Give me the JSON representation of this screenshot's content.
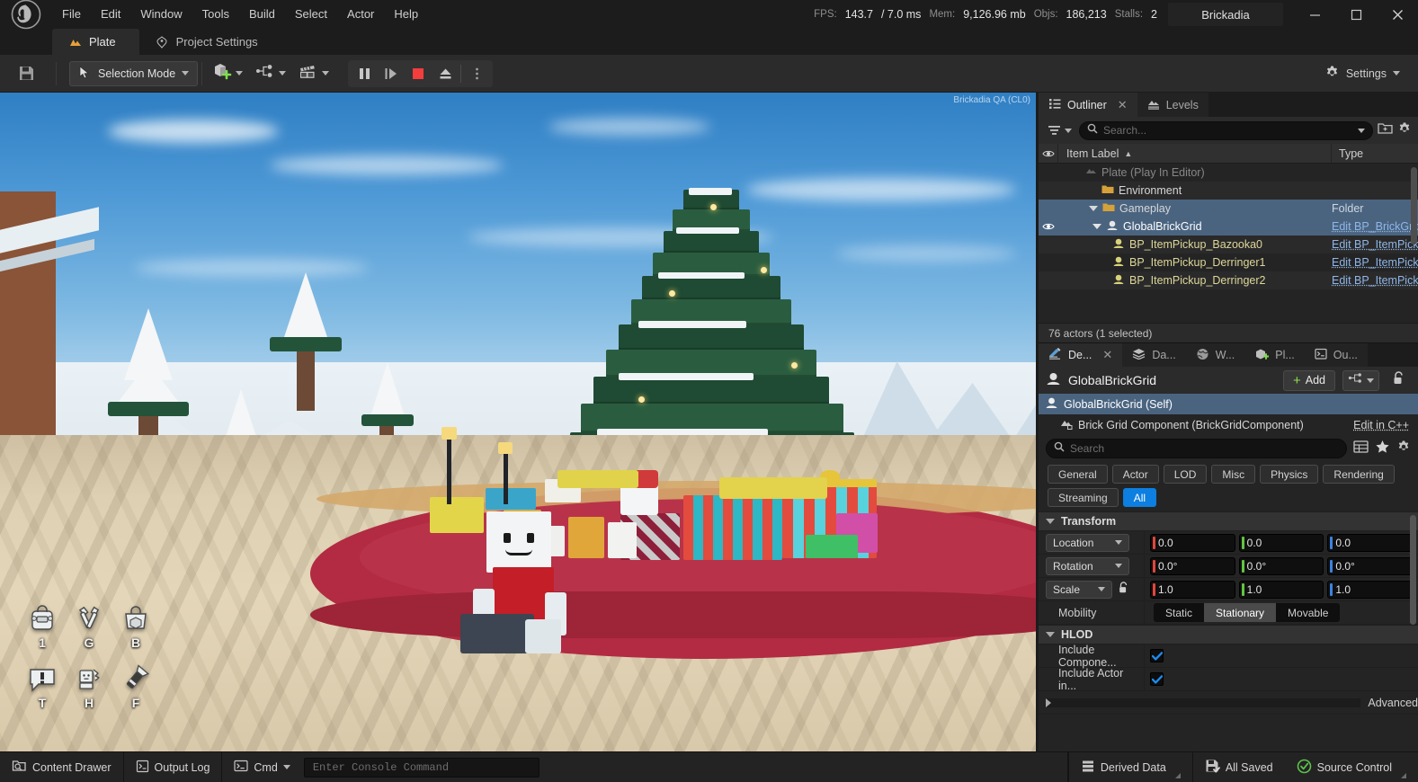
{
  "window": {
    "project_name": "Brickadia",
    "minimize": "—",
    "maximize": "□",
    "close": "✕"
  },
  "menu": {
    "items": [
      "File",
      "Edit",
      "Window",
      "Tools",
      "Build",
      "Select",
      "Actor",
      "Help"
    ]
  },
  "stats": {
    "fps_label": "FPS:",
    "fps_value": "143.7",
    "frametime": "/ 7.0 ms",
    "mem_label": "Mem:",
    "mem_value": "9,126.96 mb",
    "objs_label": "Objs:",
    "objs_value": "186,213",
    "stalls_label": "Stalls:",
    "stalls_value": "2"
  },
  "editor_tabs": [
    {
      "label": "Plate",
      "icon": "plate-icon",
      "active": true
    },
    {
      "label": "Project Settings",
      "icon": "project-settings-icon",
      "active": false
    }
  ],
  "toolbar": {
    "save_icon": "save-icon",
    "selection_mode": "Selection Mode",
    "add_content_icon": "add-content-icon",
    "blueprints_icon": "blueprints-icon",
    "cinematics_icon": "cinematics-icon",
    "pause_icon": "pause-icon",
    "frame_step_icon": "frame-step-icon",
    "stop_icon": "stop-icon",
    "eject_icon": "eject-icon",
    "more_icon": "more-options-icon",
    "settings_label": "Settings"
  },
  "viewport": {
    "watermark": "Brickadia QA (CL0)",
    "hud": [
      {
        "icon": "backpack-icon",
        "key": "1"
      },
      {
        "icon": "hammer-icon",
        "key": "G"
      },
      {
        "icon": "bag-icon",
        "key": "B"
      },
      {
        "icon": "chat-icon",
        "key": "T"
      },
      {
        "icon": "wave-icon",
        "key": "H"
      },
      {
        "icon": "flashlight-icon",
        "key": "F"
      }
    ]
  },
  "outliner": {
    "tabs": [
      {
        "label": "Outliner",
        "icon": "outliner-icon",
        "active": true,
        "closable": true
      },
      {
        "label": "Levels",
        "icon": "levels-icon",
        "active": false,
        "closable": false
      }
    ],
    "search_placeholder": "Search...",
    "columns": {
      "label": "Item Label",
      "type": "Type",
      "sort": "▲"
    },
    "rows": [
      {
        "label": "Plate (Play In Editor)",
        "type": "",
        "indent": 1,
        "icon": "level-icon",
        "dim": true,
        "eye": false,
        "sel": false,
        "arrow": "",
        "link": false
      },
      {
        "label": "Environment",
        "type": "",
        "indent": 2,
        "icon": "folder-icon",
        "dim": false,
        "eye": false,
        "sel": false,
        "arrow": "",
        "link": false
      },
      {
        "label": "Gameplay",
        "type": "Folder",
        "indent": 2,
        "icon": "folder-icon",
        "dim": false,
        "eye": false,
        "sel": false,
        "arrow": "down",
        "link": false
      },
      {
        "label": "GlobalBrickGrid",
        "type": "Edit BP_BrickGrid",
        "indent": 2,
        "icon": "actor-icon",
        "dim": false,
        "eye": true,
        "sel": true,
        "arrow": "down",
        "link": true
      },
      {
        "label": "BP_ItemPickup_Bazooka0",
        "type": "Edit BP_ItemPick",
        "indent": 3,
        "icon": "actor-icon",
        "dim": false,
        "eye": false,
        "sel": false,
        "arrow": "",
        "link": true
      },
      {
        "label": "BP_ItemPickup_Derringer1",
        "type": "Edit BP_ItemPick",
        "indent": 3,
        "icon": "actor-icon",
        "dim": false,
        "eye": false,
        "sel": false,
        "arrow": "",
        "link": true
      },
      {
        "label": "BP_ItemPickup_Derringer2",
        "type": "Edit BP_ItemPick",
        "indent": 3,
        "icon": "actor-icon",
        "dim": false,
        "eye": false,
        "sel": false,
        "arrow": "",
        "link": true
      }
    ],
    "status": "76 actors (1 selected)"
  },
  "details": {
    "tabs": [
      {
        "label": "De...",
        "icon": "details-icon",
        "active": true,
        "closable": true
      },
      {
        "label": "Da...",
        "icon": "data-layers-icon",
        "active": false,
        "closable": false
      },
      {
        "label": "W...",
        "icon": "world-settings-icon",
        "active": false,
        "closable": false
      },
      {
        "label": "Pl...",
        "icon": "place-actors-icon",
        "active": false,
        "closable": false
      },
      {
        "label": "Ou...",
        "icon": "output-log-icon",
        "active": false,
        "closable": false
      }
    ],
    "actor_name": "GlobalBrickGrid",
    "add_label": "Add",
    "add_plus": "+",
    "blueprint_icon": "blueprint-icon",
    "lock_icon": "unlock-icon",
    "components": [
      {
        "label": "GlobalBrickGrid (Self)",
        "icon": "actor-icon",
        "selected": true,
        "action": ""
      },
      {
        "label": "Brick Grid Component (BrickGridComponent)",
        "icon": "component-icon",
        "selected": false,
        "action": "Edit in C++"
      }
    ],
    "search_placeholder": "Search",
    "grid_icon": "grid-view-icon",
    "favorite_icon": "star-icon",
    "settings_icon": "gear-icon",
    "categories": [
      {
        "label": "General",
        "on": false
      },
      {
        "label": "Actor",
        "on": false
      },
      {
        "label": "LOD",
        "on": false
      },
      {
        "label": "Misc",
        "on": false
      },
      {
        "label": "Physics",
        "on": false
      },
      {
        "label": "Rendering",
        "on": false
      },
      {
        "label": "Streaming",
        "on": false
      },
      {
        "label": "All",
        "on": true
      }
    ],
    "transform": {
      "section": "Transform",
      "location": {
        "label": "Location",
        "x": "0.0",
        "y": "0.0",
        "z": "0.0"
      },
      "rotation": {
        "label": "Rotation",
        "x": "0.0°",
        "y": "0.0°",
        "z": "0.0°"
      },
      "scale": {
        "label": "Scale",
        "x": "1.0",
        "y": "1.0",
        "z": "1.0"
      },
      "mobility": {
        "label": "Mobility",
        "options": [
          "Static",
          "Stationary",
          "Movable"
        ],
        "selected": "Stationary"
      }
    },
    "hlod": {
      "section": "HLOD",
      "include_component": {
        "label": "Include Compone...",
        "checked": true
      },
      "include_actor": {
        "label": "Include Actor in...",
        "checked": true
      },
      "advanced": "Advanced"
    }
  },
  "statusbar": {
    "content_drawer": "Content Drawer",
    "output_log": "Output Log",
    "cmd_label": "Cmd",
    "console_placeholder": "Enter Console Command",
    "derived_data": "Derived Data",
    "all_saved": "All Saved",
    "source_control": "Source Control"
  },
  "colors": {
    "accent_blue": "#0c7fe0",
    "selection_blue": "#4a6480",
    "link_blue": "#8fb6e8",
    "stop_red": "#f43d3d",
    "add_green": "#8ede4f",
    "axis_x": "#e1463c",
    "axis_y": "#63c442",
    "axis_z": "#3c82e1",
    "folder_orange": "#d7a13a",
    "actor_yellow": "#d8d27a",
    "source_control_green": "#5ec14c"
  }
}
